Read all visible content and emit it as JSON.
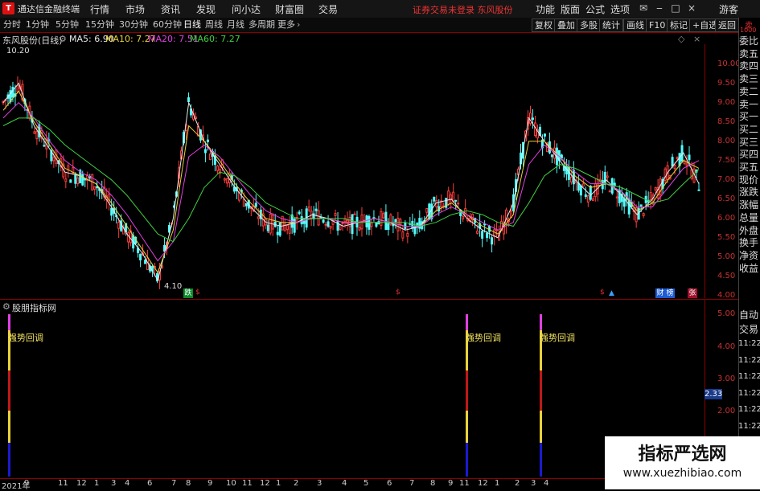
{
  "app": {
    "title": "通达信金融终端",
    "logo": "T"
  },
  "menu": [
    "行情",
    "市场",
    "资讯",
    "发现",
    "问小达",
    "财富圈",
    "交易"
  ],
  "notice": "证券交易未登录  东风股份",
  "right_menu": [
    "功能",
    "版面",
    "公式",
    "选项"
  ],
  "guest": "游客",
  "periods": [
    "分时",
    "1分钟",
    "5分钟",
    "15分钟",
    "30分钟",
    "60分钟",
    "日线",
    "周线",
    "月线",
    "多周期",
    "更多"
  ],
  "active_period": "日线",
  "toolbar_right": [
    "复权",
    "叠加",
    "多股",
    "统计",
    "画线",
    "F10",
    "标记",
    "+自选",
    "返回"
  ],
  "stock": {
    "name": "东风股份(日线)"
  },
  "ma": [
    {
      "label": "MA5: 6.90",
      "color": "#e8e8e8"
    },
    {
      "label": "MA10: 7.27",
      "color": "#e8d23a"
    },
    {
      "label": "MA20: 7.51",
      "color": "#e040e0"
    },
    {
      "label": "MA60: 7.27",
      "color": "#40d040"
    }
  ],
  "price_high_label": "10.20",
  "price_low_label": "4.10",
  "price_axis": [
    "10.00",
    "9.50",
    "9.00",
    "8.50",
    "8.00",
    "7.50",
    "7.00",
    "6.50",
    "6.00",
    "5.50",
    "5.00",
    "4.50",
    "4.00"
  ],
  "markers": {
    "die": "跌",
    "cai": "财",
    "bang": "榜",
    "zhang": "张"
  },
  "indicator": {
    "name": "股朋指标网",
    "signal_label": "强势回调"
  },
  "indicator_axis": [
    "5.00",
    "4.00",
    "3.00",
    "2.00"
  ],
  "indicator_value": "2.33",
  "x_axis": [
    "2021年",
    "9",
    "11",
    "12",
    "1",
    "3",
    "4",
    "6",
    "7",
    "8",
    "9",
    "10",
    "11",
    "12",
    "1",
    "2",
    "3",
    "4",
    "5",
    "6",
    "7",
    "8",
    "9",
    "11",
    "12",
    "1",
    "2",
    "3",
    "4"
  ],
  "side_buttons": [
    "委比",
    "卖五",
    "卖四",
    "卖三",
    "卖二",
    "卖一",
    "买一",
    "买二",
    "买三",
    "买四",
    "买五",
    "现价",
    "涨跌",
    "涨幅",
    "总量",
    "外盘",
    "换手",
    "净资",
    "收益"
  ],
  "side_bottom": [
    "自动",
    "交易"
  ],
  "side_times": [
    "11:22",
    "11:22",
    "11:22",
    "11:22",
    "11:22",
    "11:22",
    "11:22",
    "11:22",
    "11:22"
  ],
  "side_top": "卖",
  "side_top2": "1000",
  "watermark": {
    "line1": "指标严选网",
    "line2": "www.xuezhibiao.com"
  },
  "chart_data": {
    "type": "line",
    "title": "东风股份(日线)",
    "ylim": [
      4.0,
      10.2
    ],
    "series": [
      {
        "name": "MA5",
        "values": [
          9.0,
          9.5,
          8.4,
          7.8,
          7.2,
          7.1,
          6.9,
          6.3,
          5.6,
          5.1,
          4.4,
          6.0,
          9.0,
          8.0,
          7.4,
          6.8,
          6.3,
          5.9,
          5.8,
          5.9,
          6.1,
          6.0,
          5.8,
          5.9,
          6.0,
          5.9,
          5.7,
          5.8,
          6.4,
          6.5,
          6.0,
          5.7,
          5.5,
          6.4,
          8.6,
          8.0,
          7.5,
          7.0,
          6.6,
          7.0,
          6.6,
          6.1,
          6.5,
          7.2,
          7.7,
          6.9
        ]
      },
      {
        "name": "MA10",
        "values": [
          8.8,
          9.3,
          8.5,
          7.9,
          7.3,
          7.1,
          6.9,
          6.4,
          5.8,
          5.2,
          4.6,
          5.7,
          8.4,
          8.0,
          7.5,
          6.9,
          6.4,
          6.0,
          5.9,
          5.9,
          6.0,
          6.0,
          5.9,
          5.9,
          6.0,
          5.9,
          5.8,
          5.8,
          6.2,
          6.4,
          6.1,
          5.8,
          5.6,
          6.1,
          8.0,
          8.0,
          7.6,
          7.1,
          6.8,
          6.9,
          6.7,
          6.2,
          6.4,
          7.0,
          7.5,
          7.3
        ]
      },
      {
        "name": "MA20",
        "values": [
          8.6,
          9.0,
          8.6,
          8.0,
          7.5,
          7.2,
          7.0,
          6.6,
          6.1,
          5.5,
          4.9,
          5.4,
          7.6,
          7.9,
          7.6,
          7.1,
          6.6,
          6.2,
          6.0,
          5.9,
          6.0,
          6.0,
          5.9,
          5.9,
          6.0,
          5.9,
          5.8,
          5.8,
          6.1,
          6.3,
          6.1,
          5.9,
          5.7,
          5.9,
          7.4,
          7.9,
          7.6,
          7.2,
          6.9,
          6.9,
          6.7,
          6.3,
          6.3,
          6.8,
          7.3,
          7.5
        ]
      },
      {
        "name": "MA60",
        "values": [
          8.4,
          8.6,
          8.6,
          8.3,
          7.9,
          7.6,
          7.3,
          7.0,
          6.6,
          6.1,
          5.6,
          5.4,
          6.0,
          6.8,
          7.2,
          7.1,
          6.8,
          6.4,
          6.2,
          6.0,
          6.0,
          6.0,
          6.0,
          5.9,
          5.9,
          5.9,
          5.9,
          5.8,
          5.9,
          6.1,
          6.2,
          6.1,
          5.9,
          5.8,
          6.4,
          7.1,
          7.4,
          7.3,
          7.1,
          6.9,
          6.8,
          6.6,
          6.4,
          6.5,
          6.9,
          7.27
        ]
      }
    ],
    "signals": [
      {
        "x": 2
      },
      {
        "x": 571
      },
      {
        "x": 663
      }
    ]
  }
}
